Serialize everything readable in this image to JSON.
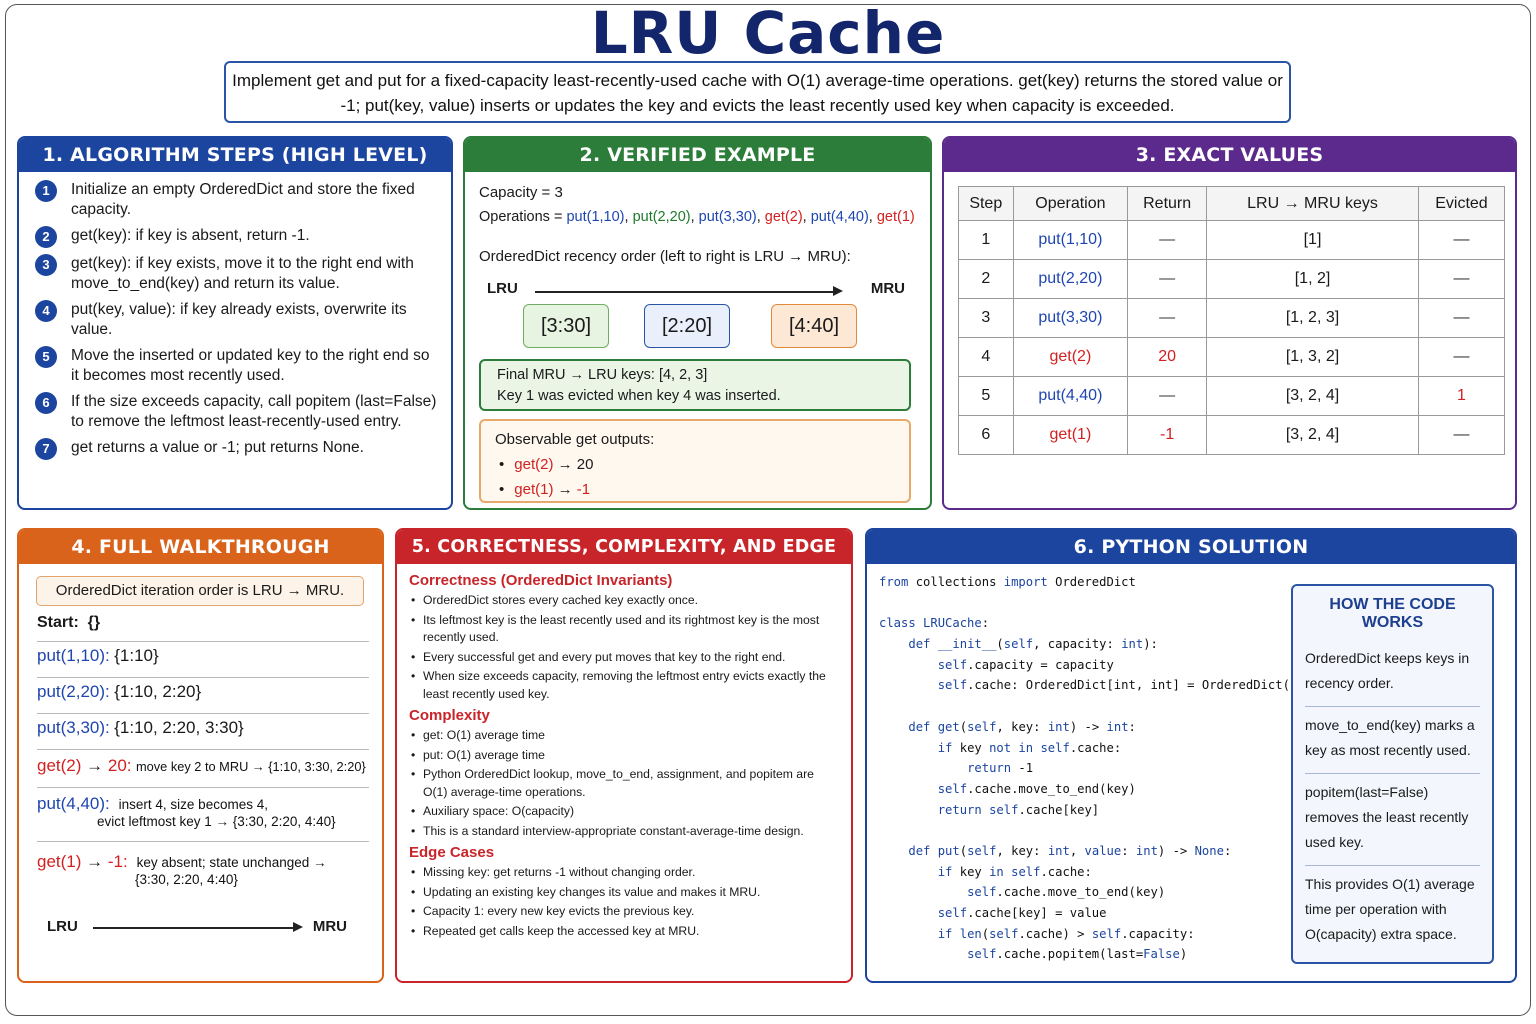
{
  "title": "LRU Cache",
  "subtitle": "Implement get and put for a fixed-capacity least-recently-used cache with O(1) average-time operations. get(key) returns the stored value or -1; put(key, value) inserts or updates the key and evicts the least recently used key when capacity is exceeded.",
  "panel1": {
    "header": "1. ALGORITHM STEPS (HIGH LEVEL)",
    "steps": [
      {
        "n": "1",
        "text": "Initialize an empty OrderedDict and store the fixed capacity."
      },
      {
        "n": "2",
        "text": "get(key): if key is absent, return -1."
      },
      {
        "n": "3",
        "text": "get(key): if key exists, move it to the right end with move_to_end(key) and return its value."
      },
      {
        "n": "4",
        "text": "put(key, value): if key already exists, overwrite its value."
      },
      {
        "n": "5",
        "text": "Move the inserted or updated key to the right end so it becomes most recently used."
      },
      {
        "n": "6",
        "text": "If the size exceeds capacity, call popitem (last=False) to remove the leftmost least-recently-used entry."
      },
      {
        "n": "7",
        "text": "get returns a value or -1; put returns None."
      }
    ]
  },
  "panel2": {
    "header": "2. VERIFIED EXAMPLE",
    "capacity": "Capacity = 3",
    "ops_label": "Operations = ",
    "ops": [
      {
        "text": "put(1,10)",
        "color": "#1f46b0"
      },
      {
        "text": "put(2,20)",
        "color": "#1f7a2e"
      },
      {
        "text": "put(3,30)",
        "color": "#1f46b0"
      },
      {
        "text": "get(2)",
        "color": "#d32020"
      },
      {
        "text": "put(4,40)",
        "color": "#1f46b0"
      },
      {
        "text": "get(1)",
        "color": "#d32020"
      }
    ],
    "recency_label": "OrderedDict recency order (left to right is LRU → MRU):",
    "lru": "LRU",
    "mru": "MRU",
    "boxes": [
      {
        "text": "[3:30]",
        "border": "#6fae62",
        "bg": "#e8f4e2"
      },
      {
        "text": "[2:20]",
        "border": "#2a55a6",
        "bg": "#eaf0fb"
      },
      {
        "text": "[4:40]",
        "border": "#e28a3c",
        "bg": "#fde8d6"
      }
    ],
    "final_line1": "Final MRU → LRU keys: [4, 2, 3]",
    "final_line2": "Key 1 was evicted when key 4 was inserted.",
    "obs_title": "Observable get outputs:",
    "obs": [
      {
        "call": "get(2)",
        "arrow": " → ",
        "result": "20"
      },
      {
        "call": "get(1)",
        "arrow": " → ",
        "result": "-1"
      }
    ]
  },
  "panel3": {
    "header": "3. EXACT VALUES",
    "columns": [
      "Step",
      "Operation",
      "Return",
      "LRU → MRU keys",
      "Evicted"
    ],
    "rows": [
      {
        "step": "1",
        "op": "put(1,10)",
        "op_color": "#1f46b0",
        "ret": "—",
        "ret_color": "#333",
        "keys": "[1]",
        "ev": "—",
        "ev_color": "#333"
      },
      {
        "step": "2",
        "op": "put(2,20)",
        "op_color": "#1f46b0",
        "ret": "—",
        "ret_color": "#333",
        "keys": "[1, 2]",
        "ev": "—",
        "ev_color": "#333"
      },
      {
        "step": "3",
        "op": "put(3,30)",
        "op_color": "#1f46b0",
        "ret": "—",
        "ret_color": "#333",
        "keys": "[1, 2, 3]",
        "ev": "—",
        "ev_color": "#333"
      },
      {
        "step": "4",
        "op": "get(2)",
        "op_color": "#d32020",
        "ret": "20",
        "ret_color": "#d32020",
        "keys": "[1, 3, 2]",
        "ev": "—",
        "ev_color": "#333"
      },
      {
        "step": "5",
        "op": "put(4,40)",
        "op_color": "#1f46b0",
        "ret": "—",
        "ret_color": "#333",
        "keys": "[3, 2, 4]",
        "ev": "1",
        "ev_color": "#d32020"
      },
      {
        "step": "6",
        "op": "get(1)",
        "op_color": "#d32020",
        "ret": "-1",
        "ret_color": "#d32020",
        "keys": "[3, 2, 4]",
        "ev": "—",
        "ev_color": "#333"
      }
    ]
  },
  "panel4": {
    "header": "4. FULL WALKTHROUGH",
    "note": "OrderedDict iteration order is LRU → MRU.",
    "start_label": "Start:",
    "start_val": "{}",
    "lines": [
      {
        "op": "put(1,10):",
        "color": "#1f46b0",
        "state": "{1:10}"
      },
      {
        "op": "put(2,20):",
        "color": "#1f46b0",
        "state": "{1:10, 2:20}"
      },
      {
        "op": "put(3,30):",
        "color": "#1f46b0",
        "state": "{1:10, 2:20, 3:30}"
      }
    ],
    "get2_op": "get(2)",
    "get2_arrow": " → ",
    "get2_res": "20:",
    "get2_desc": "move key 2 to MRU → {1:10, 3:30, 2:20}",
    "put4_op": "put(4,40):",
    "put4_desc1": "insert 4, size becomes 4,",
    "put4_desc2": "evict leftmost key 1 → {3:30, 2:20, 4:40}",
    "get1_op": "get(1)",
    "get1_arrow": " → ",
    "get1_res": "-1:",
    "get1_desc1": "key absent; state unchanged →",
    "get1_desc2": "{3:30, 2:20, 4:40}",
    "lru": "LRU",
    "mru": "MRU"
  },
  "panel5": {
    "header": "5. CORRECTNESS, COMPLEXITY, AND EDGE CASES",
    "sections": [
      {
        "title": "Correctness (OrderedDict Invariants)",
        "items": [
          "OrderedDict stores every cached key exactly once.",
          "Its leftmost key is the least recently used and its rightmost key is the most recently used.",
          "Every successful get and every put moves that key to the right end.",
          "When size exceeds capacity, removing the leftmost entry evicts exactly the least recently used key."
        ]
      },
      {
        "title": "Complexity",
        "items": [
          "get: O(1) average time",
          "put: O(1) average time",
          "Python OrderedDict lookup, move_to_end, assignment, and popitem are O(1) average-time operations.",
          "Auxiliary space: O(capacity)",
          "This is a standard interview-appropriate constant-average-time design."
        ]
      },
      {
        "title": "Edge Cases",
        "items": [
          "Missing key: get returns -1 without changing order.",
          "Updating an existing key changes its value and makes it MRU.",
          "Capacity 1: every new key evicts the previous key.",
          "Repeated get calls keep the accessed key at MRU."
        ]
      }
    ]
  },
  "panel6": {
    "header": "6. PYTHON SOLUTION",
    "code": [
      [
        {
          "t": "from",
          "k": 1
        },
        {
          "t": " collections "
        },
        {
          "t": "import",
          "k": 1
        },
        {
          "t": " OrderedDict"
        }
      ],
      [
        {
          "t": ""
        }
      ],
      [
        {
          "t": "class",
          "k": 1
        },
        {
          "t": " "
        },
        {
          "t": "LRUCache",
          "k": 1
        },
        {
          "t": ":"
        }
      ],
      [
        {
          "t": "    "
        },
        {
          "t": "def",
          "k": 1
        },
        {
          "t": " "
        },
        {
          "t": "__init__",
          "k": 1
        },
        {
          "t": "("
        },
        {
          "t": "self",
          "k": 1
        },
        {
          "t": ", capacity: "
        },
        {
          "t": "int",
          "k": 1
        },
        {
          "t": "):"
        }
      ],
      [
        {
          "t": "        "
        },
        {
          "t": "self",
          "k": 1
        },
        {
          "t": ".capacity = capacity"
        }
      ],
      [
        {
          "t": "        "
        },
        {
          "t": "self",
          "k": 1
        },
        {
          "t": ".cache: OrderedDict[int, int] = OrderedDict()"
        }
      ],
      [
        {
          "t": ""
        }
      ],
      [
        {
          "t": "    "
        },
        {
          "t": "def",
          "k": 1
        },
        {
          "t": " "
        },
        {
          "t": "get",
          "k": 1
        },
        {
          "t": "("
        },
        {
          "t": "self",
          "k": 1
        },
        {
          "t": ", key: "
        },
        {
          "t": "int",
          "k": 1
        },
        {
          "t": ") -> "
        },
        {
          "t": "int",
          "k": 1
        },
        {
          "t": ":"
        }
      ],
      [
        {
          "t": "        "
        },
        {
          "t": "if",
          "k": 1
        },
        {
          "t": " key "
        },
        {
          "t": "not in",
          "k": 1
        },
        {
          "t": " "
        },
        {
          "t": "self",
          "k": 1
        },
        {
          "t": ".cache:"
        }
      ],
      [
        {
          "t": "            "
        },
        {
          "t": "return",
          "k": 1
        },
        {
          "t": " -1"
        }
      ],
      [
        {
          "t": "        "
        },
        {
          "t": "self",
          "k": 1
        },
        {
          "t": ".cache.move_to_end(key)"
        }
      ],
      [
        {
          "t": "        "
        },
        {
          "t": "return",
          "k": 1
        },
        {
          "t": " "
        },
        {
          "t": "self",
          "k": 1
        },
        {
          "t": ".cache[key]"
        }
      ],
      [
        {
          "t": ""
        }
      ],
      [
        {
          "t": "    "
        },
        {
          "t": "def",
          "k": 1
        },
        {
          "t": " "
        },
        {
          "t": "put",
          "k": 1
        },
        {
          "t": "("
        },
        {
          "t": "self",
          "k": 1
        },
        {
          "t": ", key: "
        },
        {
          "t": "int",
          "k": 1
        },
        {
          "t": ", "
        },
        {
          "t": "value",
          "k": 1
        },
        {
          "t": ": "
        },
        {
          "t": "int",
          "k": 1
        },
        {
          "t": ") -> "
        },
        {
          "t": "None",
          "k": 1
        },
        {
          "t": ":"
        }
      ],
      [
        {
          "t": "        "
        },
        {
          "t": "if",
          "k": 1
        },
        {
          "t": " key "
        },
        {
          "t": "in",
          "k": 1
        },
        {
          "t": " "
        },
        {
          "t": "self",
          "k": 1
        },
        {
          "t": ".cache:"
        }
      ],
      [
        {
          "t": "            "
        },
        {
          "t": "self",
          "k": 1
        },
        {
          "t": ".cache.move_to_end(key)"
        }
      ],
      [
        {
          "t": "        "
        },
        {
          "t": "self",
          "k": 1
        },
        {
          "t": ".cache[key] = value"
        }
      ],
      [
        {
          "t": "        "
        },
        {
          "t": "if",
          "k": 1
        },
        {
          "t": " "
        },
        {
          "t": "len",
          "k": 1
        },
        {
          "t": "("
        },
        {
          "t": "self",
          "k": 1
        },
        {
          "t": ".cache) > "
        },
        {
          "t": "self",
          "k": 1
        },
        {
          "t": ".capacity:"
        }
      ],
      [
        {
          "t": "            "
        },
        {
          "t": "self",
          "k": 1
        },
        {
          "t": ".cache.popitem(last="
        },
        {
          "t": "False",
          "k": 1
        },
        {
          "t": ")"
        }
      ]
    ],
    "how_title": "HOW THE CODE WORKS",
    "how_items": [
      "OrderedDict keeps keys in recency order.",
      "move_to_end(key) marks a key as most recently used.",
      "popitem(last=False) removes the least recently used key.",
      "This provides O(1) average time per operation with O(capacity) extra space."
    ]
  }
}
